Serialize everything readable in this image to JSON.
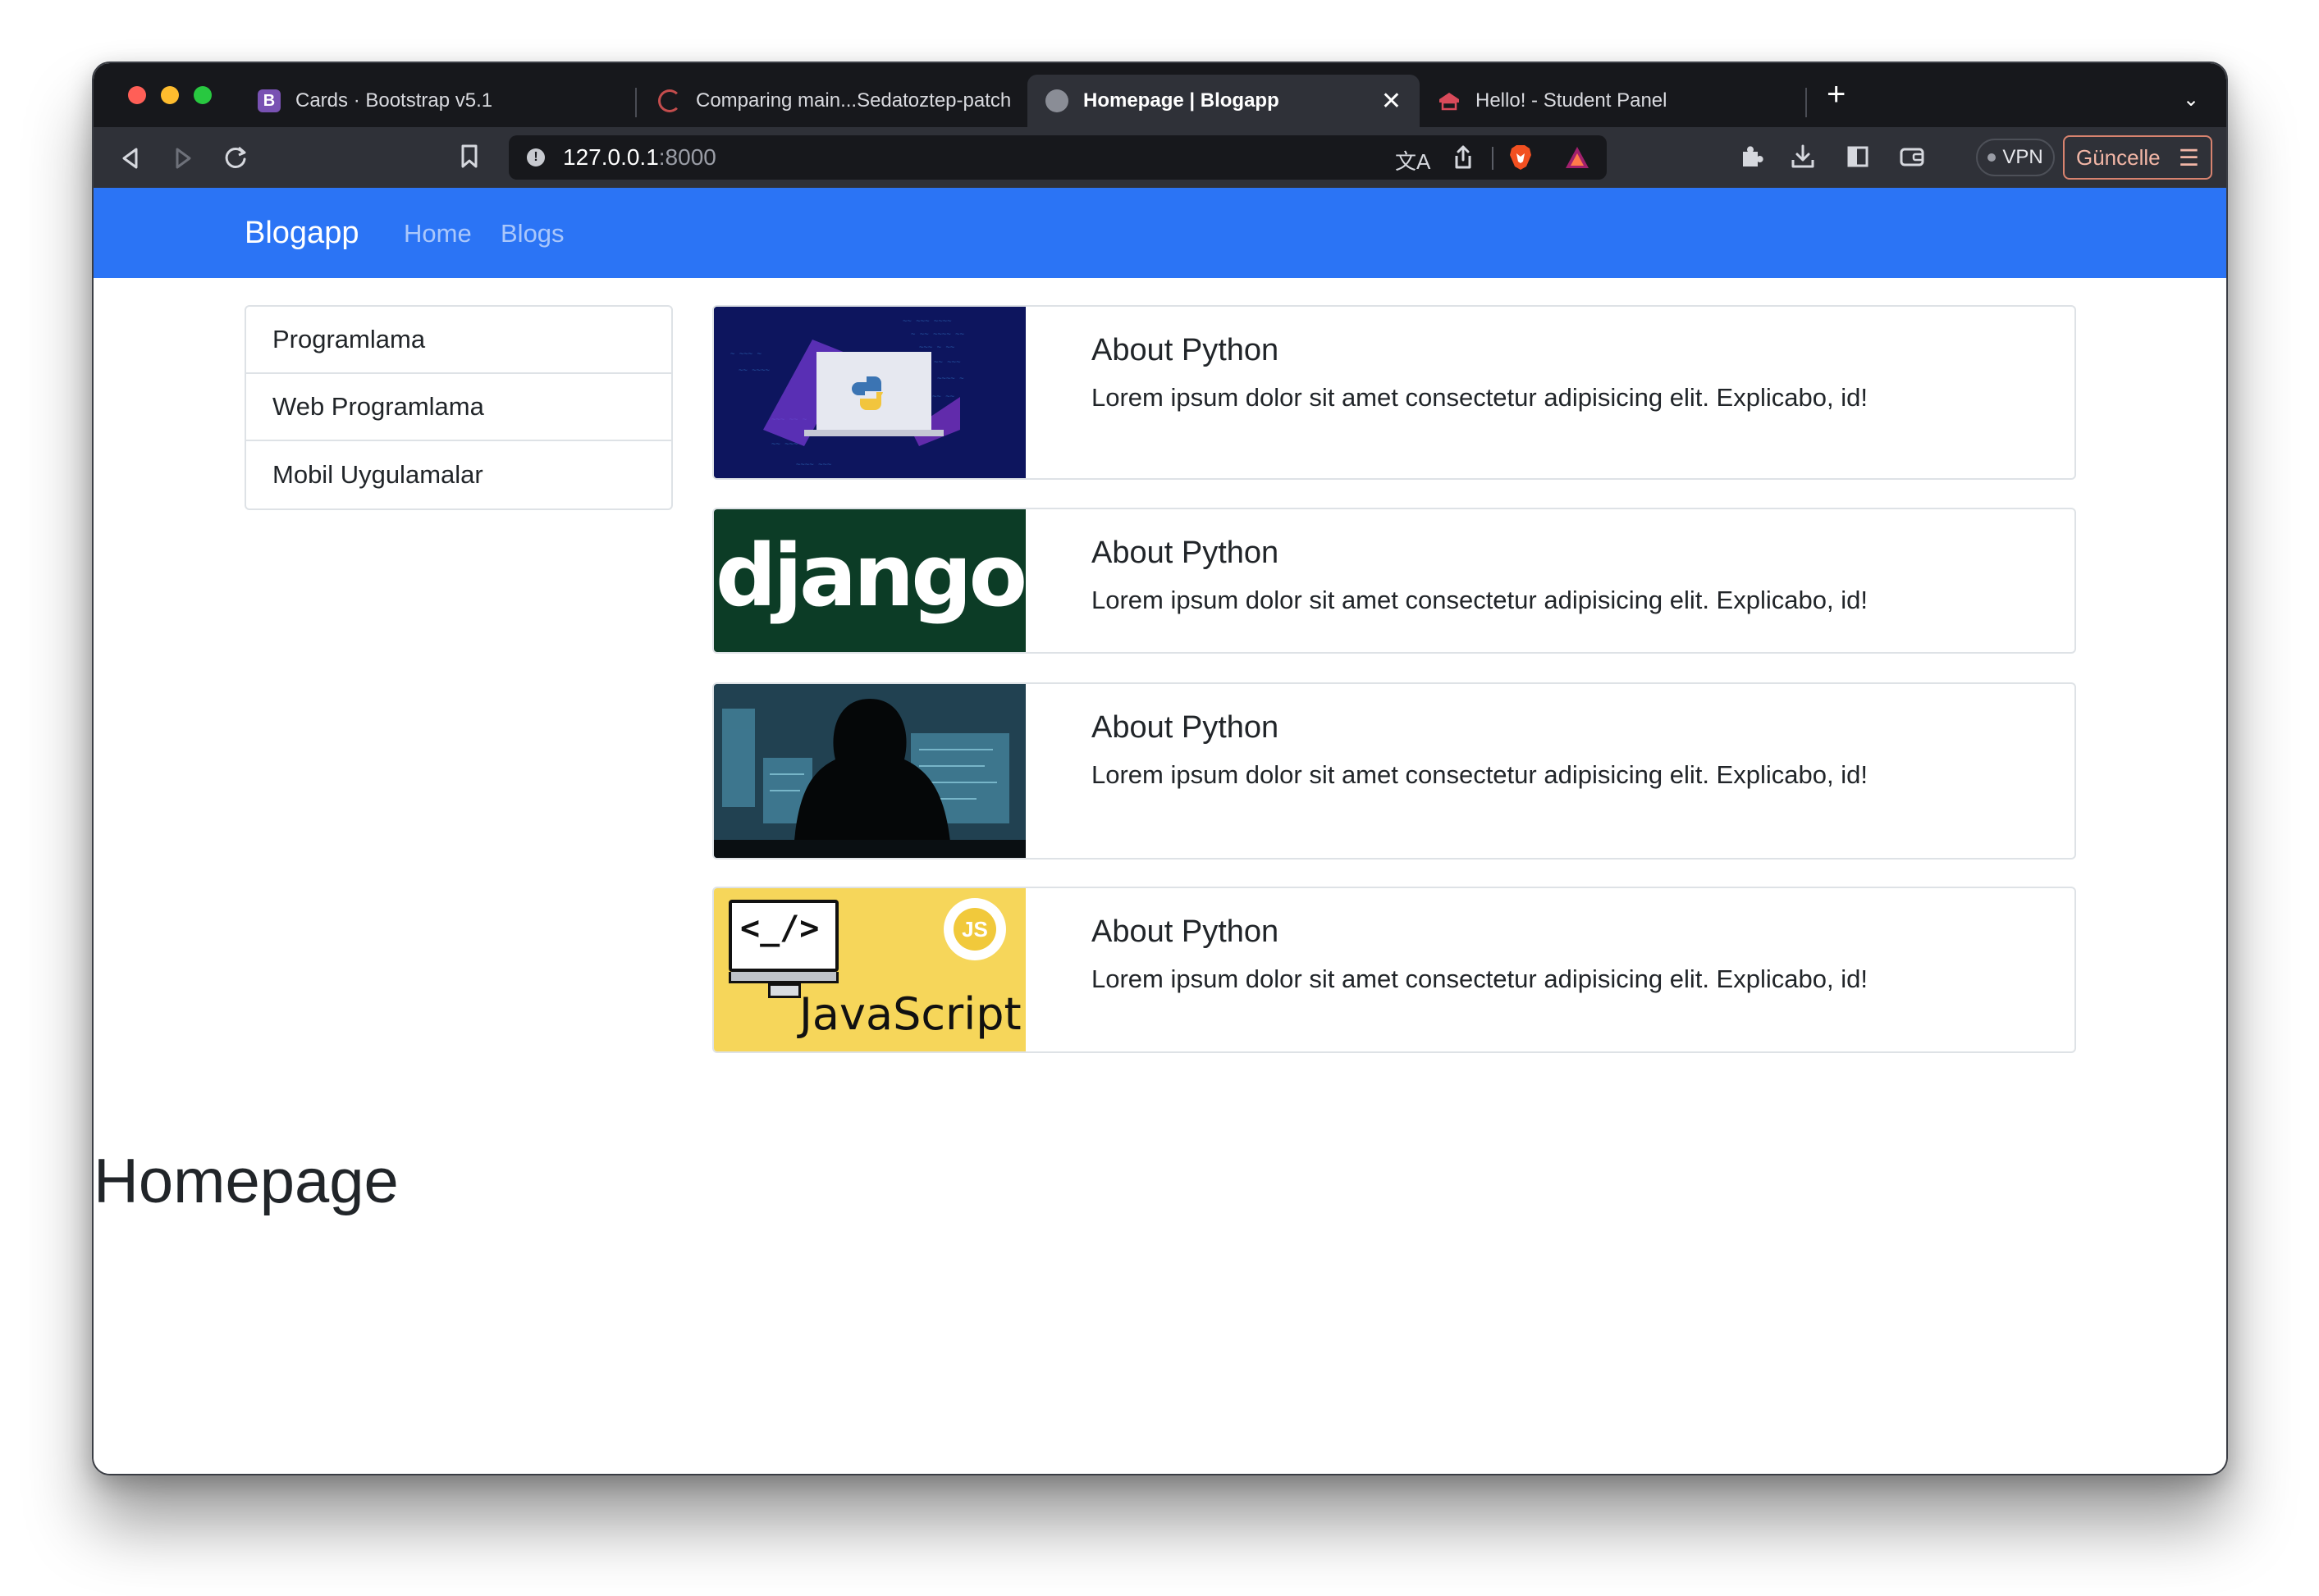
{
  "browser": {
    "tabs": [
      {
        "title": "Cards · Bootstrap v5.1",
        "favicon": "bootstrap-icon",
        "active": false
      },
      {
        "title": "Comparing main...Sedatoztep-patch",
        "favicon": "loading-spinner-icon",
        "active": false
      },
      {
        "title": "Homepage | Blogapp",
        "favicon": "globe-icon",
        "active": true
      },
      {
        "title": "Hello! - Student Panel",
        "favicon": "student-panel-icon",
        "active": false
      }
    ],
    "url_host": "127.0.0.1",
    "url_port": ":8000",
    "vpn_label": "VPN",
    "update_label": "Güncelle",
    "update_color": "#d8836f"
  },
  "navbar": {
    "brand": "Blogapp",
    "links": [
      "Home",
      "Blogs"
    ],
    "background": "#2b74f5"
  },
  "sidebar": {
    "categories": [
      "Programlama",
      "Web Programlama",
      "Mobil Uygulamalar"
    ]
  },
  "cards": [
    {
      "image": "python-laptop-image",
      "title": "About Python",
      "text": "Lorem ipsum dolor sit amet consectetur adipisicing elit. Explicabo, id!"
    },
    {
      "image": "django-logo-image",
      "image_text": "django",
      "title": "About Python",
      "text": "Lorem ipsum dolor sit amet consectetur adipisicing elit. Explicabo, id!"
    },
    {
      "image": "hooded-hacker-image",
      "title": "About Python",
      "text": "Lorem ipsum dolor sit amet consectetur adipisicing elit. Explicabo, id!"
    },
    {
      "image": "javascript-illustration-image",
      "image_text": "JavaScript",
      "code_glyph": "<_/>",
      "badge_text": "JS",
      "title": "About Python",
      "text": "Lorem ipsum dolor sit amet consectetur adipisicing elit. Explicabo, id!"
    }
  ],
  "page": {
    "heading": "Homepage"
  }
}
